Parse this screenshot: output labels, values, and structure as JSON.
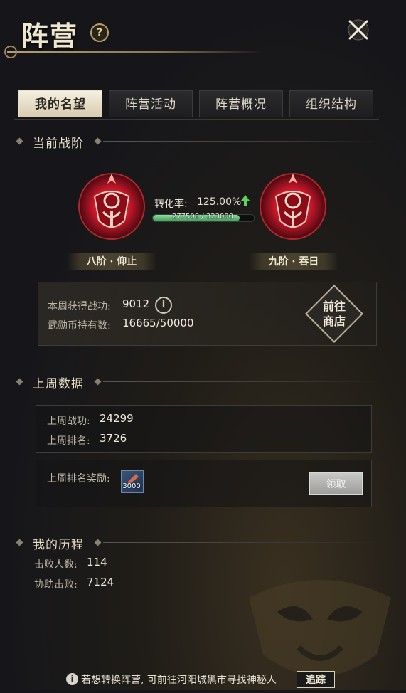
{
  "header": {
    "title": "阵营"
  },
  "tabs": [
    {
      "label": "我的名望",
      "active": true
    },
    {
      "label": "阵营活动",
      "active": false
    },
    {
      "label": "阵营概况",
      "active": false
    },
    {
      "label": "组织结构",
      "active": false
    }
  ],
  "current_rank": {
    "section_title": "当前战阶",
    "conversion_label": "转化率:",
    "conversion_value": "125.00%",
    "progress_text": "277508 / 323000",
    "progress_current": 277508,
    "progress_max": 323000,
    "current_rank_name": "八阶 · 仰止",
    "next_rank_name": "九阶 · 吞日",
    "week_merit_label": "本周获得战功:",
    "week_merit_value": "9012",
    "coin_label": "武勋币持有数:",
    "coin_value": "16665/50000",
    "shop_label_line1": "前往",
    "shop_label_line2": "商店"
  },
  "last_week": {
    "section_title": "上周数据",
    "merit_label": "上周战功:",
    "merit_value": "24299",
    "rank_label": "上周排名:",
    "rank_value": "3726",
    "reward_label": "上周排名奖励:",
    "reward_count": "3000",
    "claim_label": "领取"
  },
  "history": {
    "section_title": "我的历程",
    "defeated_label": "击败人数:",
    "defeated_value": "114",
    "assist_label": "协助击败:",
    "assist_value": "7124"
  },
  "footer": {
    "tip_text": "若想转换阵营, 可前往河阳城黑市寻找神秘人",
    "track_label": "追踪"
  },
  "colors": {
    "accent_gold": "#b8a070",
    "badge_red": "#c8182a",
    "progress_green": "#3d9e58",
    "up_arrow_green": "#5fd35f"
  }
}
